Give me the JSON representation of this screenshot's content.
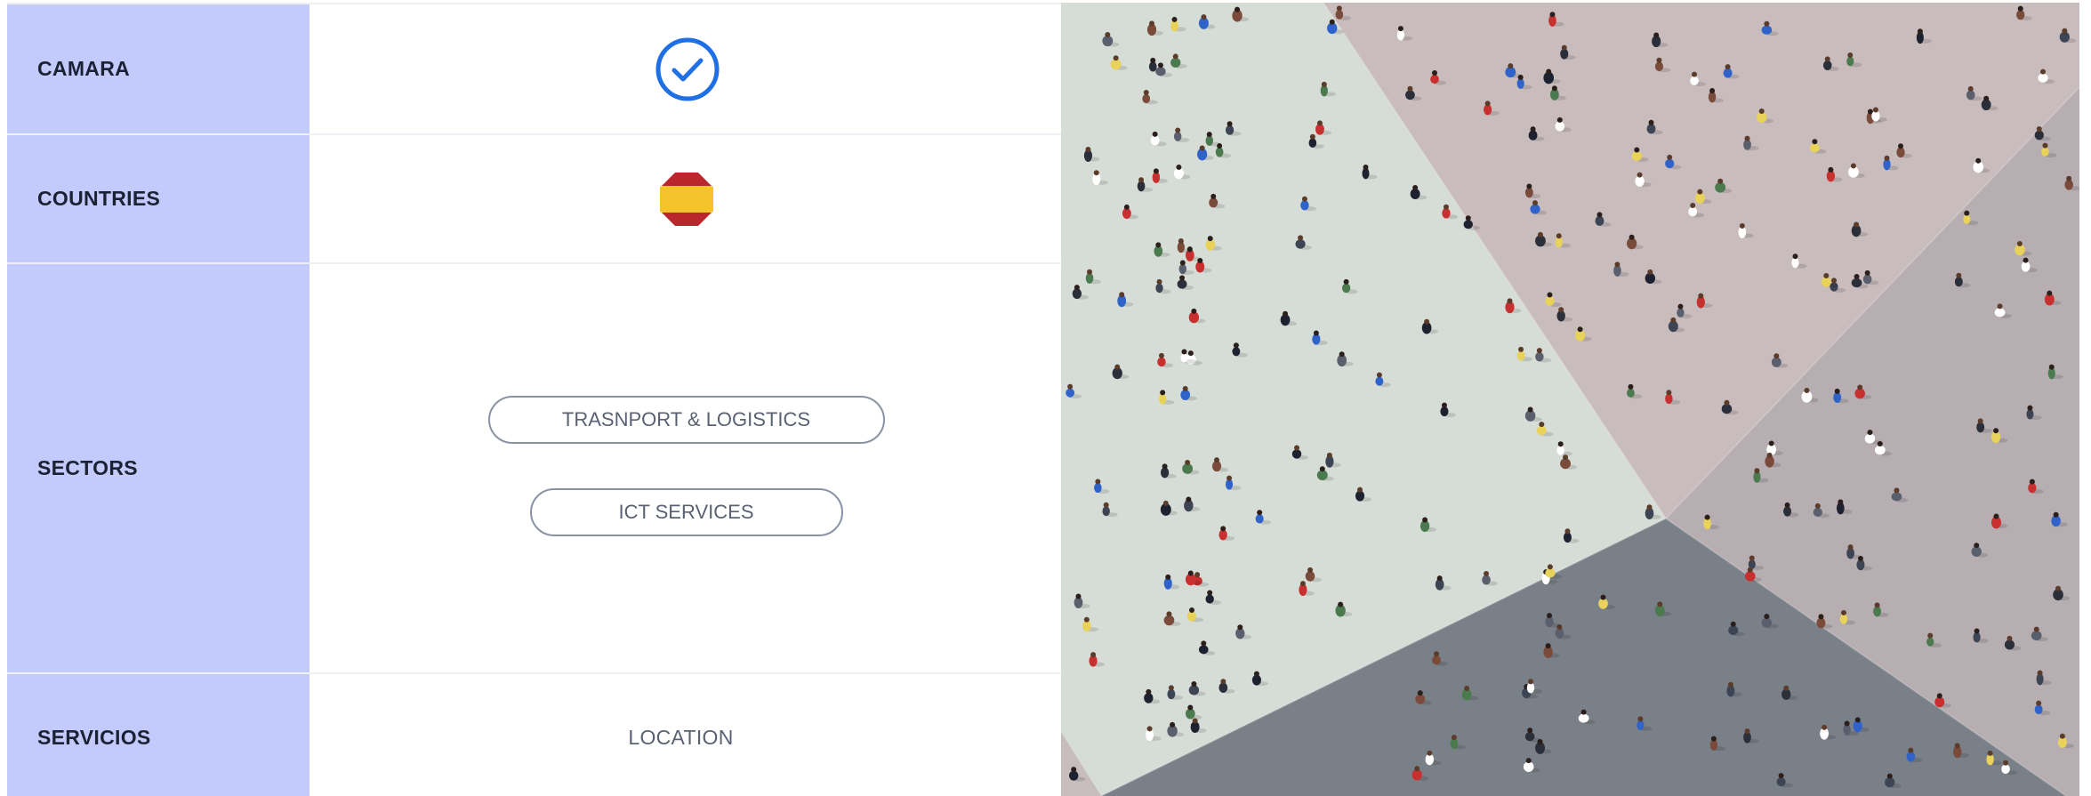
{
  "table": {
    "rows": [
      {
        "label": "CAMARA",
        "value_icon": "check-circle-icon"
      },
      {
        "label": "COUNTRIES",
        "value_icon": "spain-flag-icon"
      },
      {
        "label": "SECTORS",
        "tags": [
          "TRASNPORT & LOGISTICS",
          "ICT SERVICES"
        ]
      },
      {
        "label": "SERVICIOS",
        "value": "LOCATION"
      }
    ]
  },
  "image": {
    "subject": "aerial-crowd-photo"
  },
  "colors": {
    "label_background": "#c3cbfd",
    "check_blue": "#1f6fe5",
    "pill_border": "#8a93a3",
    "flag_red": "#b9262b",
    "flag_yellow": "#f5c42c"
  }
}
